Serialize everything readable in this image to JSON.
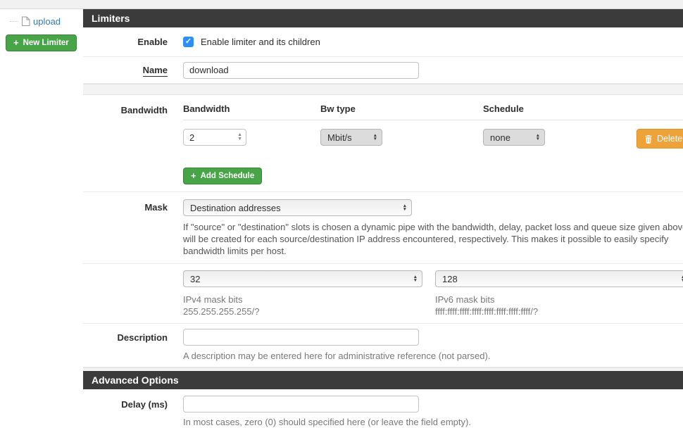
{
  "sidebar": {
    "upload_label": "upload",
    "new_limiter_label": "New Limiter"
  },
  "limiters_panel": {
    "title": "Limiters",
    "enable": {
      "label": "Enable",
      "checkbox_label": "Enable limiter and its children",
      "checked": true,
      "check_glyph": "✓"
    },
    "name": {
      "label": "Name",
      "value": "download"
    },
    "bandwidth": {
      "label": "Bandwidth",
      "columns": [
        "Bandwidth",
        "Bw type",
        "Schedule"
      ],
      "row": {
        "bandwidth_value": "2",
        "bw_type": "Mbit/s",
        "schedule": "none",
        "delete_label": "Delete"
      },
      "add_schedule_label": "Add Schedule"
    },
    "mask": {
      "label": "Mask",
      "value": "Destination addresses",
      "help": "If \"source\" or \"destination\" slots is chosen a dynamic pipe with the bandwidth, delay, packet loss and queue size given above will be created for each source/destination IP address encountered, respectively. This makes it possible to easily specify bandwidth limits per host.",
      "ipv4": {
        "value": "32",
        "help_line1": "IPv4 mask bits",
        "help_line2": "255.255.255.255/?"
      },
      "ipv6": {
        "value": "128",
        "help_line1": "IPv6 mask bits",
        "help_line2": "ffff:ffff:ffff:ffff:ffff:ffff:ffff:ffff/?"
      }
    },
    "description": {
      "label": "Description",
      "value": "",
      "help": "A description may be entered here for administrative reference (not parsed)."
    }
  },
  "advanced_panel": {
    "title": "Advanced Options",
    "delay": {
      "label": "Delay (ms)",
      "value": "",
      "help": "In most cases, zero (0) should specified here (or leave the field empty)."
    }
  },
  "misc": {
    "plus_glyph": "+",
    "up_arrow": "▲",
    "down_arrow": "▼"
  },
  "colors": {
    "panel_header_bg": "#3b3b3b",
    "success_green": "#47a447",
    "warning_orange": "#eda338",
    "link_blue": "#337ab7",
    "checkbox_blue": "#2f8ef5"
  }
}
